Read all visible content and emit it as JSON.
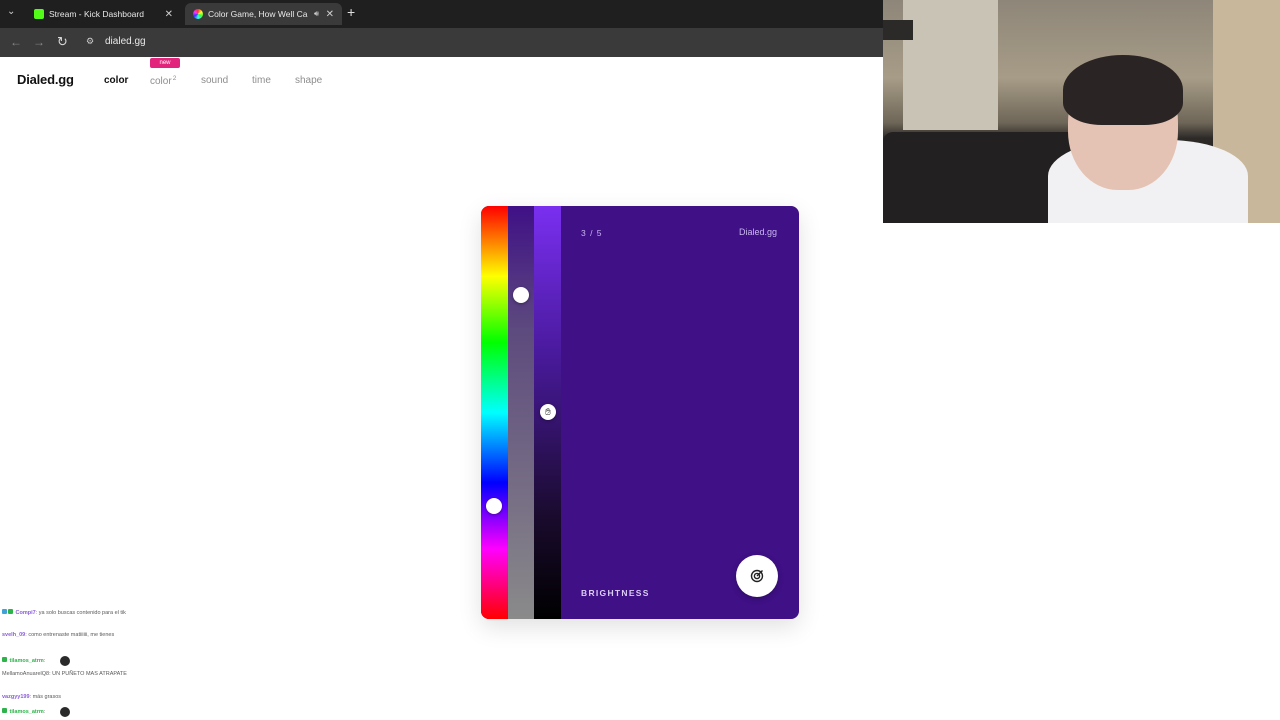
{
  "browser": {
    "tabs": [
      {
        "title": "Stream - Kick Dashboard",
        "active": false
      },
      {
        "title": "Color Game, How Well Can",
        "active": true
      }
    ],
    "url": "dialed.gg"
  },
  "site": {
    "logo": "Dialed.gg",
    "nav": [
      "color",
      "color",
      "sound",
      "time",
      "shape"
    ],
    "color2_sup": "2",
    "new_badge": "new"
  },
  "game": {
    "progress": "3 / 5",
    "brand": "Dialed.gg",
    "mode": "BRIGHTNESS",
    "current_color": "#3f1086"
  },
  "chat": [
    {
      "user": "Compi7",
      "text": "ya solo buscas contenido para el tik"
    },
    {
      "user": "svelh_09",
      "text": "como entrenaste matiiiiii, me tienes"
    },
    {
      "user": "tilamos_atrm",
      "text": ""
    },
    {
      "user": "",
      "text": "MellamoAnuarelQ8: UN PUÑETO MAS ATRAPATE"
    },
    {
      "user": "vazgyy199",
      "text": "más grasos"
    },
    {
      "user": "tilamos_atrm",
      "text": ""
    }
  ]
}
